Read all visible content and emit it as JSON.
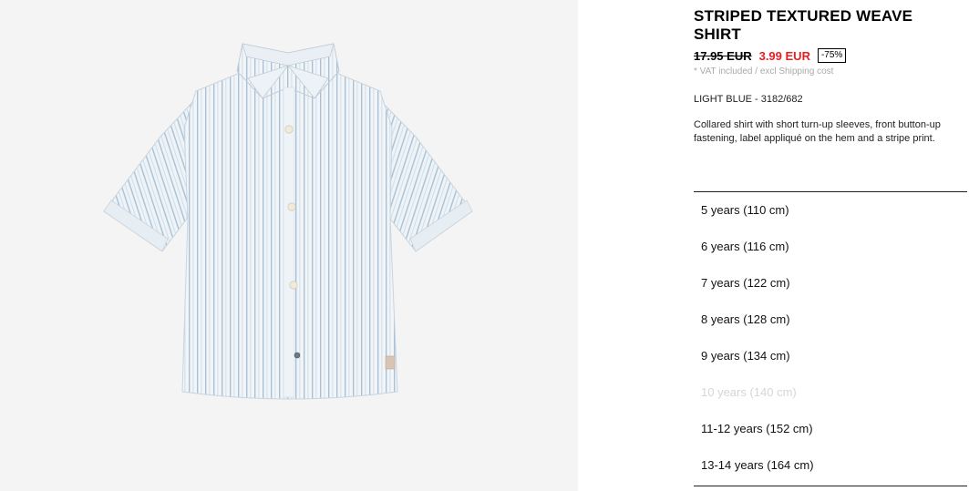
{
  "product": {
    "title": "STRIPED TEXTURED WEAVE SHIRT",
    "image_alt": "light blue striped short-sleeve shirt",
    "price": {
      "original": "17.95 EUR",
      "sale": "3.99 EUR",
      "discount": "-75%",
      "sale_color": "#e62020"
    },
    "vat_note": "* VAT included / excl Shipping cost",
    "color_ref": "LIGHT BLUE - 3182/682",
    "description": "Collared shirt with short turn-up sleeves, front button-up fastening, label appliqué on the hem and a stripe print."
  },
  "sizes": [
    {
      "label": "5 years (110 cm)",
      "available": true
    },
    {
      "label": "6 years (116 cm)",
      "available": true
    },
    {
      "label": "7 years (122 cm)",
      "available": true
    },
    {
      "label": "8 years (128 cm)",
      "available": true
    },
    {
      "label": "9 years (134 cm)",
      "available": true
    },
    {
      "label": "10 years (140 cm)",
      "available": false
    },
    {
      "label": "11-12 years (152 cm)",
      "available": true
    },
    {
      "label": "13-14 years (164 cm)",
      "available": true
    }
  ]
}
